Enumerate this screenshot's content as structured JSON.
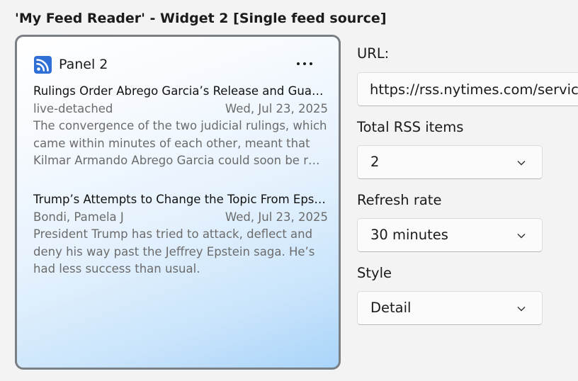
{
  "window": {
    "title": "'My Feed Reader' - Widget 2 [Single feed source]"
  },
  "widget": {
    "panel_name": "Panel 2",
    "more_icon": "ellipsis-icon",
    "feed_icon": "rss-icon",
    "accent": "#2f6fd6",
    "items": [
      {
        "title": "Rulings Order Abrego Garcia’s Release and Guar…",
        "author": "live-detached",
        "date": "Wed, Jul 23, 2025",
        "description": "The convergence of the two judicial rulings, which came within minutes of each other, meant that Kilmar Armando Abrego Garcia could soon be r…"
      },
      {
        "title": "Trump’s Attempts to Change the Topic From Epst…",
        "author": "Bondi, Pamela J",
        "date": "Wed, Jul 23, 2025",
        "description": "President Trump has tried to attack, deflect and deny his way past the Jeffrey Epstein saga. He’s had less success than usual."
      }
    ]
  },
  "settings": {
    "url_label": "URL:",
    "url_value": "https://rss.nytimes.com/services/xml/rss/nyt/HomePage.xml",
    "total_label": "Total RSS items",
    "total_value": "2",
    "refresh_label": "Refresh rate",
    "refresh_value": "30 minutes",
    "style_label": "Style",
    "style_value": "Detail"
  }
}
